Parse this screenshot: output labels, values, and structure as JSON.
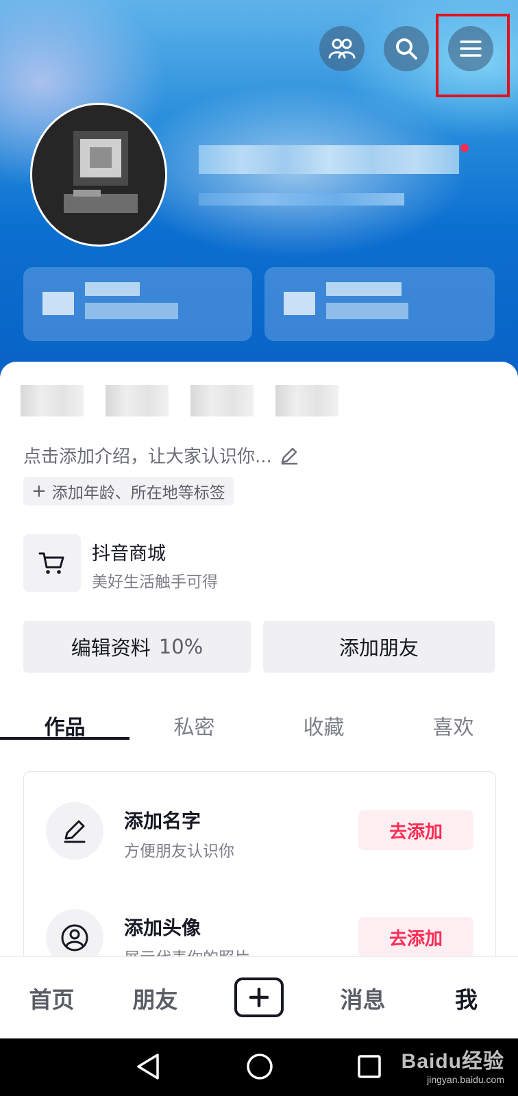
{
  "bio": {
    "placeholder_text": "点击添加介绍，让大家认识你...",
    "add_tags_text": "添加年龄、所在地等标签"
  },
  "shop": {
    "title": "抖音商城",
    "subtitle": "美好生活触手可得"
  },
  "actions": {
    "edit_profile_label": "编辑资料",
    "edit_profile_percent": "10%",
    "add_friends_label": "添加朋友"
  },
  "tabs": [
    {
      "label": "作品",
      "active": true
    },
    {
      "label": "私密",
      "active": false
    },
    {
      "label": "收藏",
      "active": false
    },
    {
      "label": "喜欢",
      "active": false
    }
  ],
  "tasks": [
    {
      "title": "添加名字",
      "subtitle": "方便朋友认识你",
      "button": "去添加",
      "icon": "pencil-icon"
    },
    {
      "title": "添加头像",
      "subtitle": "展示代表你的照片",
      "button": "去添加",
      "icon": "user-circle-icon"
    }
  ],
  "bottom_nav": [
    {
      "label": "首页",
      "active": false
    },
    {
      "label": "朋友",
      "active": false
    },
    {
      "label": "消息",
      "active": false
    },
    {
      "label": "我",
      "active": true
    }
  ],
  "watermark": {
    "logo": "Baidu经验",
    "url": "jingyan.baidu.com"
  },
  "colors": {
    "accent": "#fe2c55",
    "highlight_box": "#e0131c",
    "hero_blue": "#0b6fd0"
  }
}
